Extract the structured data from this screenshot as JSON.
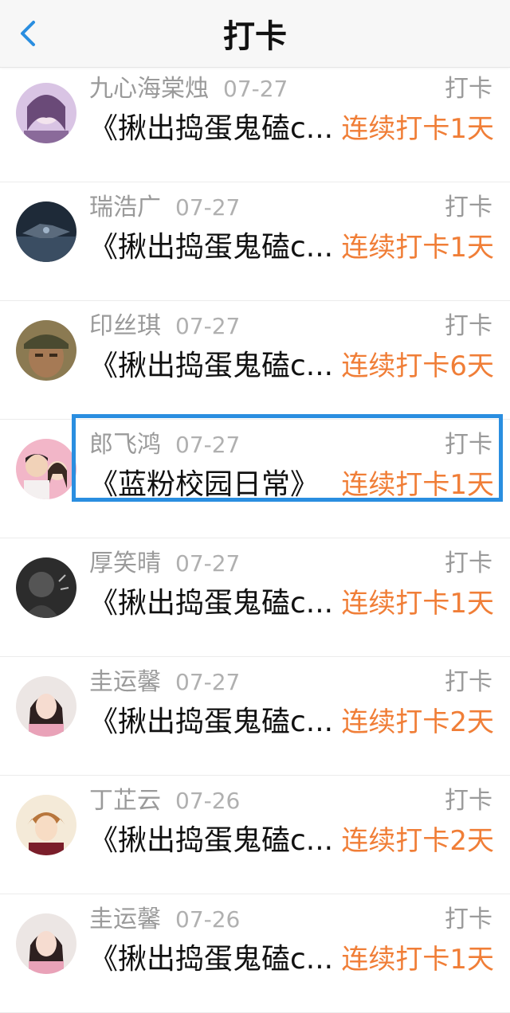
{
  "header": {
    "title": "打卡"
  },
  "entries": [
    {
      "name": "九心海棠烛",
      "date": "07-27",
      "action": "打卡",
      "book": "《揪出捣蛋鬼磕c...",
      "streak": "连续打卡1天",
      "avatar_icon": "purple-anime-girl-avatar",
      "avatar_color": "#c8a8d8"
    },
    {
      "name": "瑞浩广",
      "date": "07-27",
      "action": "打卡",
      "book": "《揪出捣蛋鬼磕c...",
      "streak": "连续打卡1天",
      "avatar_icon": "dark-spaceship-avatar",
      "avatar_color": "#2e3b4e"
    },
    {
      "name": "印丝琪",
      "date": "07-27",
      "action": "打卡",
      "book": "《揪出捣蛋鬼磕c...",
      "streak": "连续打卡6天",
      "avatar_icon": "man-with-cap-avatar",
      "avatar_color": "#6b5a3a"
    },
    {
      "name": "郎飞鸿",
      "date": "07-27",
      "action": "打卡",
      "book": "《蓝粉校园日常》",
      "streak": "连续打卡1天",
      "avatar_icon": "couple-photo-avatar",
      "avatar_color": "#e7a8c0"
    },
    {
      "name": "厚笑晴",
      "date": "07-27",
      "action": "打卡",
      "book": "《揪出捣蛋鬼磕c...",
      "streak": "连续打卡1天",
      "avatar_icon": "dark-portrait-avatar",
      "avatar_color": "#3a3a3a"
    },
    {
      "name": "圭运馨",
      "date": "07-27",
      "action": "打卡",
      "book": "《揪出捣蛋鬼磕c...",
      "streak": "连续打卡2天",
      "avatar_icon": "girl-portrait-avatar",
      "avatar_color": "#e8c8cc"
    },
    {
      "name": "丁芷云",
      "date": "07-26",
      "action": "打卡",
      "book": "《揪出捣蛋鬼磕c...",
      "streak": "连续打卡2天",
      "avatar_icon": "anime-boy-avatar",
      "avatar_color": "#d69a6a"
    },
    {
      "name": "圭运馨",
      "date": "07-26",
      "action": "打卡",
      "book": "《揪出捣蛋鬼磕c...",
      "streak": "连续打卡1天",
      "avatar_icon": "girl-portrait-avatar",
      "avatar_color": "#e8c8cc"
    }
  ],
  "colors": {
    "accent_back": "#2a8ee0",
    "streak": "#f07e37",
    "highlight": "#2a8ee0"
  }
}
